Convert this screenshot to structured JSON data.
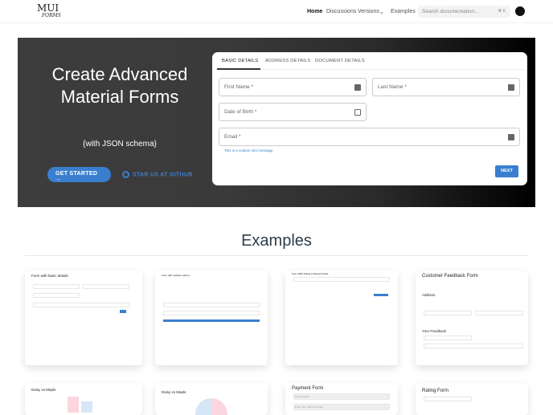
{
  "header": {
    "logo_top": "MUI",
    "logo_bottom": "FORMS",
    "nav": [
      "Home",
      "Discussions",
      "Versions",
      "Examples"
    ],
    "search_placeholder": "Search documentation...",
    "search_kbd": "⌘ K"
  },
  "hero": {
    "title": "Create Advanced Material Forms",
    "subtitle": "{with JSON schema}",
    "get_started": "GET STARTED →",
    "star": "STAR US AT GITHUB"
  },
  "form": {
    "tabs": [
      "BASIC DETAILS",
      "ADDRESS DETAILS",
      "DOCUMENT DETAILS"
    ],
    "first_name": "First Name *",
    "last_name": "Last Name *",
    "dob": "Date of Birth *",
    "email": "Email *",
    "info": "This is a custom info message",
    "next": "NEXT"
  },
  "examples": {
    "title": "Examples",
    "cards": [
      {
        "title": "Form with basic details"
      },
      {
        "title": "Form with multiple options"
      },
      {
        "title": "Form With Dialog & Repeat Fields"
      },
      {
        "title": "Customer Feedback Form",
        "sections": [
          "Address",
          "Your Feedback"
        ]
      },
      {
        "title": "Daisy vs Maple"
      },
      {
        "title": "Daisy vs Maple"
      },
      {
        "title": "Payment Form",
        "fields": [
          "Card Number",
          "Enter Your Name On Card"
        ]
      },
      {
        "title": "Rating Form"
      }
    ]
  }
}
